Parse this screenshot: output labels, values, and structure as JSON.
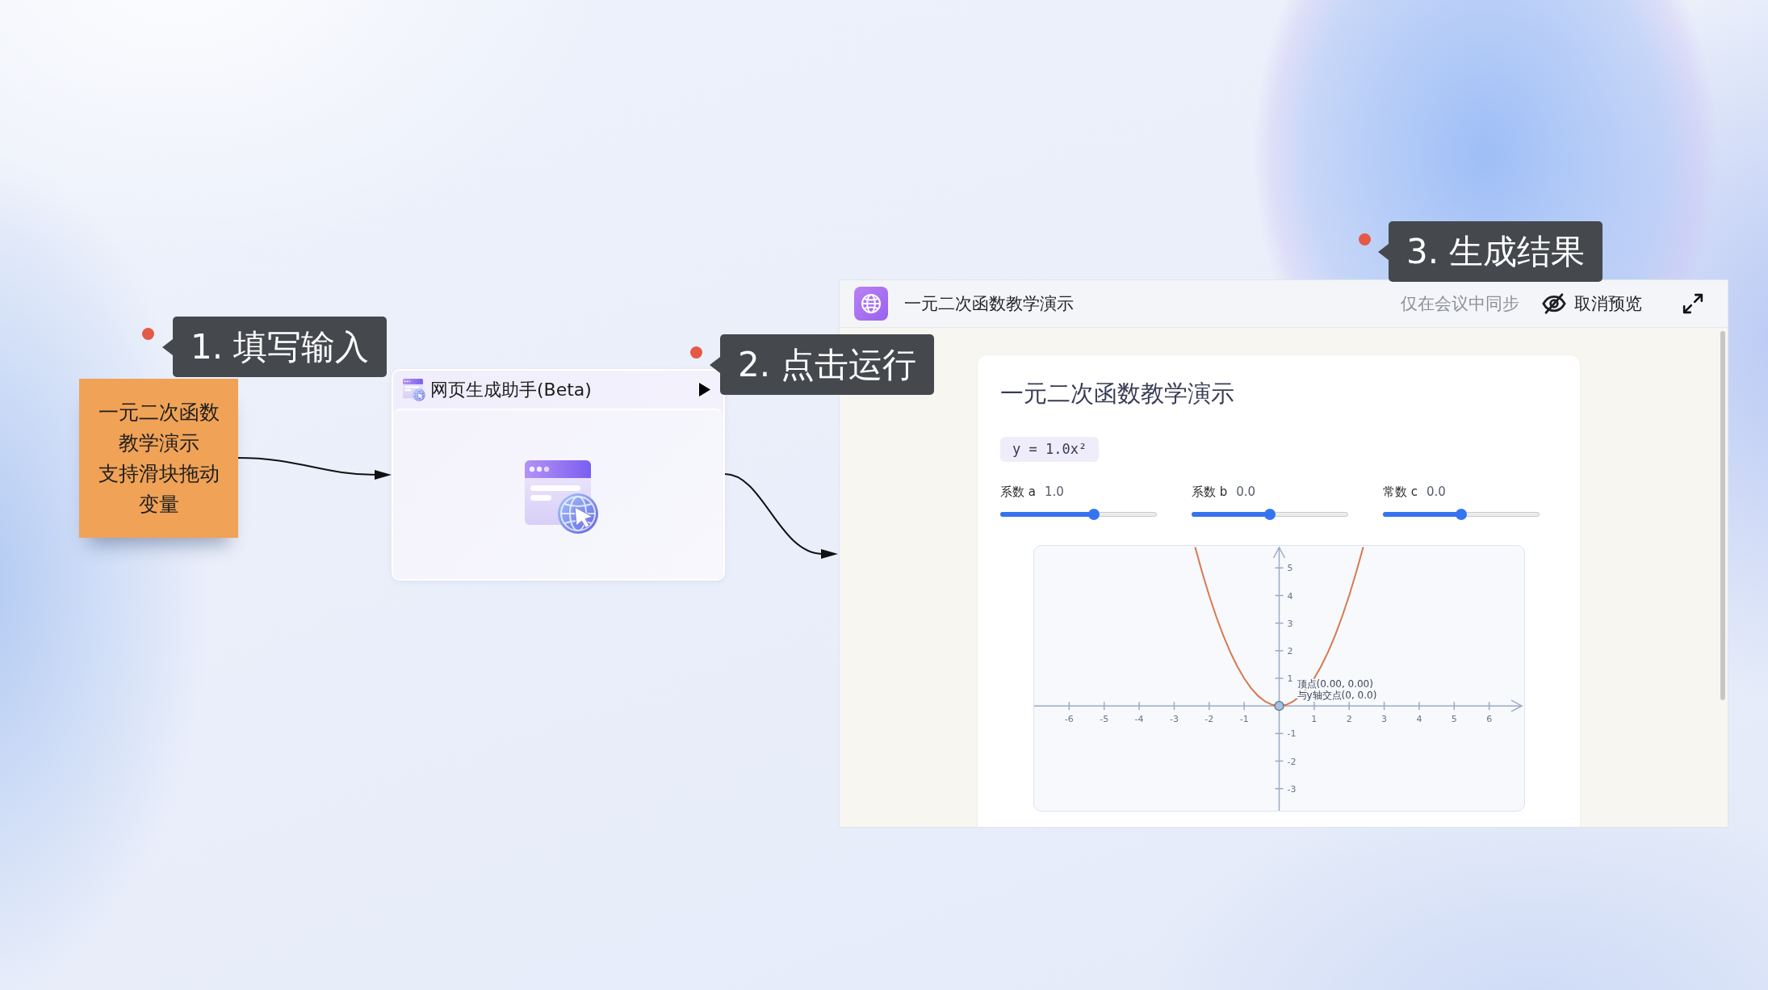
{
  "input_note": {
    "callout": "1. 填写输入",
    "lines": [
      "一元二次函数",
      "教学演示",
      "支持滑块拖动",
      "变量"
    ]
  },
  "generator_node": {
    "callout": "2. 点击运行",
    "title": "网页生成助手(Beta)"
  },
  "preview": {
    "callout": "3. 生成结果",
    "title": "一元二次函数教学演示",
    "sync_note": "仅在会议中同步",
    "cancel_button": "取消预览",
    "page": {
      "title": "一元二次函数教学演示",
      "formula": "y = 1.0x²",
      "sliders": [
        {
          "label": "系数 a",
          "reading": "1.0",
          "level": 0.6
        },
        {
          "label": "系数 b",
          "reading": "0.0",
          "level": 0.5
        },
        {
          "label": "常数 c",
          "reading": "0.0",
          "level": 0.5
        }
      ],
      "chart_data": {
        "type": "line",
        "x": [
          -2.4,
          -2.2,
          -2,
          -1.8,
          -1.6,
          -1.4,
          -1.2,
          -1,
          -0.8,
          -0.6,
          -0.4,
          -0.2,
          0,
          0.2,
          0.4,
          0.6,
          0.8,
          1,
          1.2,
          1.4,
          1.6,
          1.8,
          2,
          2.2,
          2.4
        ],
        "series": [
          {
            "color": "#d9784f",
            "values": [
              5.76,
              4.84,
              4,
              3.24,
              2.56,
              1.96,
              1.44,
              1,
              0.64,
              0.36,
              0.16,
              0.04,
              0,
              0.04,
              0.16,
              0.36,
              0.64,
              1,
              1.44,
              1.96,
              2.56,
              3.24,
              4,
              4.84,
              5.76
            ]
          }
        ],
        "xlim": [
          -7,
          7
        ],
        "ylim": [
          -3.8,
          5.8
        ],
        "xticks": [
          -6,
          -5,
          -4,
          -3,
          -2,
          -1,
          1,
          2,
          3,
          4,
          5,
          6
        ],
        "yticks": [
          -3,
          -2,
          -1,
          1,
          2,
          3,
          4,
          5
        ],
        "annotations": [
          {
            "x": 0,
            "y": 0,
            "text": "顶点(0.00, 0.00)"
          },
          {
            "x": 0,
            "y": 0,
            "text": "与y轴交点(0, 0.0)"
          }
        ]
      }
    }
  }
}
